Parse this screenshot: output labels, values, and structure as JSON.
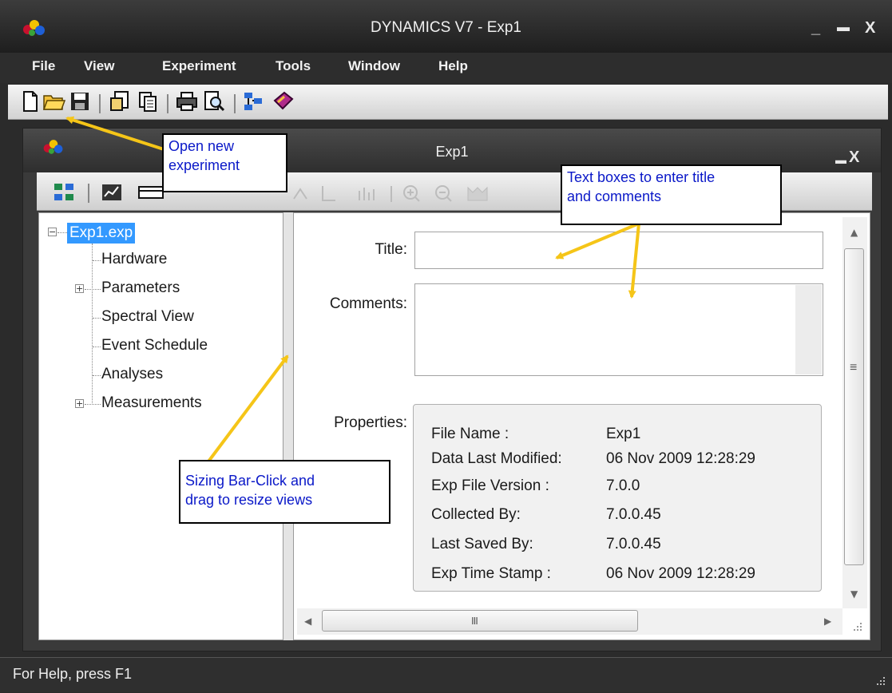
{
  "window": {
    "title": "DYNAMICS V7 - Exp1",
    "minimize_glyph": "_",
    "maximize_glyph": "▬",
    "close_glyph": "X"
  },
  "menu": [
    "File",
    "View",
    "Experiment",
    "Tools",
    "Window",
    "Help"
  ],
  "toolbar": {
    "icons": [
      "new-file-icon",
      "open-folder-icon",
      "save-icon",
      "import-icon",
      "export-icon",
      "print-icon",
      "print-preview-icon",
      "hardware-config-icon",
      "help-book-icon"
    ]
  },
  "child_window": {
    "title": "Exp1",
    "maximize_glyph": "▬",
    "close_glyph": "X"
  },
  "tree": {
    "root": "Exp1.exp",
    "items": [
      {
        "label": "Hardware",
        "expandable": false
      },
      {
        "label": "Parameters",
        "expandable": true
      },
      {
        "label": "Spectral View",
        "expandable": false
      },
      {
        "label": "Event Schedule",
        "expandable": false
      },
      {
        "label": "Analyses",
        "expandable": false
      },
      {
        "label": "Measurements",
        "expandable": true
      }
    ]
  },
  "form": {
    "title_label": "Title:",
    "title_value": "",
    "comments_label": "Comments:",
    "comments_value": "",
    "properties_label": "Properties:"
  },
  "properties": [
    {
      "key": "File Name :",
      "value": "Exp1"
    },
    {
      "key": "Data Last Modified:",
      "value": "06 Nov 2009 12:28:29"
    },
    {
      "key": "Exp File Version :",
      "value": "7.0.0"
    },
    {
      "key": "Collected By:",
      "value": "7.0.0.45"
    },
    {
      "key": "Last Saved By:",
      "value": "7.0.0.45"
    },
    {
      "key": "Exp Time Stamp :",
      "value": "06 Nov 2009 12:28:29"
    }
  ],
  "scrollbar": {
    "grip_glyph": "≡",
    "hgrip_glyph": "III"
  },
  "status": {
    "text": "For Help, press F1"
  },
  "callouts": {
    "open_new_line1": "Open new",
    "open_new_line2": "experiment",
    "text_boxes_line1": "Text boxes to enter title",
    "text_boxes_line2": "and comments",
    "sizing_line1": "Sizing Bar-Click and",
    "sizing_line2": "drag to resize views"
  },
  "colors": {
    "callout_text": "#0a18c8",
    "arrow": "#f5c518",
    "tree_selection": "#3399ff"
  }
}
